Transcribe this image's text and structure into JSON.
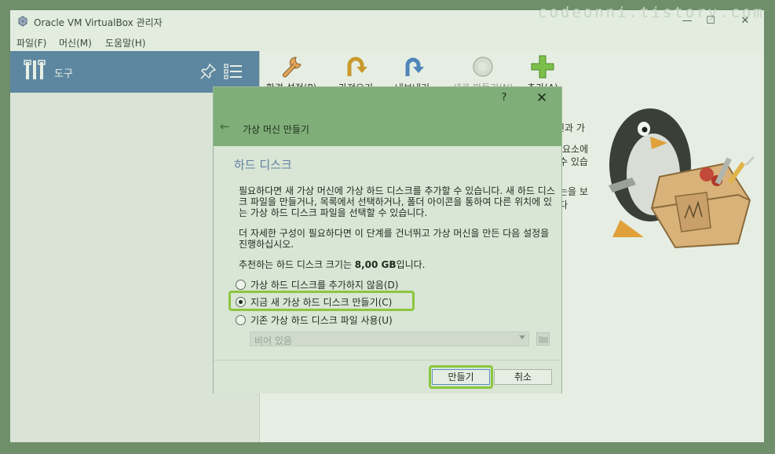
{
  "window": {
    "title": "Oracle VM VirtualBox 관리자",
    "watermark": "codeonni.tistory.com",
    "controls": {
      "minimize": "—",
      "maximize": "☐",
      "close": "✕"
    }
  },
  "menu": {
    "file": "파일(F)",
    "machine": "머신(M)",
    "help": "도움말(H)"
  },
  "sidebar": {
    "tools_label": "도구"
  },
  "toolbar": {
    "preferences": "환경 설정(P)",
    "import": "가져오기",
    "export": "내보내기",
    "new": "새로 만들기(N)",
    "add": "추가(A)"
  },
  "welcome": {
    "line1": "신과 가",
    "line2": "요소에",
    "line3": "수 있습",
    "line4": "는을 보",
    "line5": "다"
  },
  "dialog": {
    "help": "?",
    "close": "✕",
    "back": "←",
    "wizard_title": "가상 머신 만들기",
    "page_title": "하드 디스크",
    "para1": "필요하다면 새 가상 머신에 가상 하드 디스크를 추가할 수 있습니다. 새 하드 디스크 파일을 만들거나, 목록에서 선택하거나, 폴더 아이콘을 통하여 다른 위치에 있는 가상 하드 디스크 파일을 선택할 수 있습니다.",
    "para2": "더 자세한 구성이 필요하다면 이 단계를 건너뛰고 가상 머신을 만든 다음 설정을 진행하십시오.",
    "recommend_prefix": "추천하는 하드 디스크 크기는 ",
    "recommend_size": "8,00 GB",
    "recommend_suffix": "입니다.",
    "options": [
      {
        "label": "가상 하드 디스크를 추가하지 않음(D)",
        "selected": false
      },
      {
        "label": "지금 새 가상 하드 디스크 만들기(C)",
        "selected": true
      },
      {
        "label": "기존 가상 하드 디스크 파일 사용(U)",
        "selected": false
      }
    ],
    "combo_value": "비어 있음",
    "create_button": "만들기",
    "cancel_button": "취소"
  },
  "colors": {
    "accent_highlight": "#8cc63f",
    "sidebar_selected": "#5d87a0",
    "dialog_header": "#7fae78"
  }
}
